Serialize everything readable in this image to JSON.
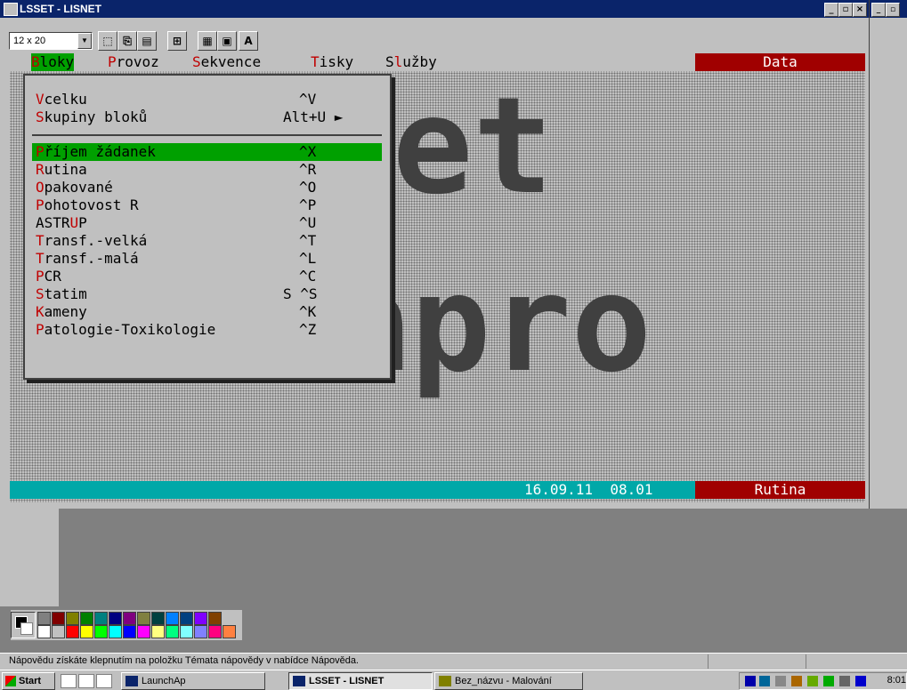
{
  "window": {
    "title": "LSSET - LISNET",
    "minimize": "_",
    "maximize": "▫",
    "close": "×"
  },
  "toolbar": {
    "font_size": "12 x 20",
    "font_button": "A"
  },
  "menubar": {
    "items": [
      {
        "hot": "B",
        "rest": "loky"
      },
      {
        "hot": "P",
        "rest": "rovoz"
      },
      {
        "hot": "S",
        "rest": "ekvence"
      },
      {
        "hot": "T",
        "rest": "isky"
      },
      {
        "pre": "S",
        "hot": "l",
        "rest": "užby"
      }
    ],
    "data_label": "Data"
  },
  "dropdown": {
    "top": [
      {
        "hot": "V",
        "rest": "celku",
        "shortcut": "^V"
      },
      {
        "hot": "S",
        "rest": "kupiny bloků",
        "shortcut": "Alt+U ►"
      }
    ],
    "items": [
      {
        "hot": "P",
        "rest": "říjem žádanek",
        "shortcut": "^X"
      },
      {
        "hot": "R",
        "rest": "utina",
        "shortcut": "^R"
      },
      {
        "hot": "O",
        "rest": "pakované",
        "shortcut": "^O"
      },
      {
        "hot": "P",
        "rest": "ohotovost R",
        "shortcut": "^P"
      },
      {
        "pre": "ASTR",
        "hot": "U",
        "rest": "P",
        "shortcut": "^U"
      },
      {
        "hot": "T",
        "rest": "ransf.-velká",
        "shortcut": "^T"
      },
      {
        "hot": "T",
        "rest": "ransf.-malá",
        "shortcut": "^L"
      },
      {
        "hot": "P",
        "rest": "CR",
        "shortcut": "^C"
      },
      {
        "hot": "S",
        "rest": "tatim",
        "shortcut": "S ^S"
      },
      {
        "hot": "K",
        "rest": "ameny",
        "shortcut": "^K"
      },
      {
        "hot": "P",
        "rest": "atologie-Toxikologie",
        "shortcut": "^Z"
      }
    ]
  },
  "logo": {
    "line1": "et",
    "line2": "apro"
  },
  "status": {
    "date": "16.09.11",
    "time": "08.01",
    "mode": "Rutina"
  },
  "paint": {
    "hint": "Nápovědu získáte klepnutím na položku Témata nápovědy v nabídce Nápověda.",
    "colors_top": [
      "#808080",
      "#800000",
      "#808000",
      "#008000",
      "#008080",
      "#000080",
      "#800080",
      "#808040",
      "#004040",
      "#0080ff",
      "#004080",
      "#8000ff",
      "#804000"
    ],
    "colors_bottom": [
      "#ffffff",
      "#c0c0c0",
      "#ff0000",
      "#ffff00",
      "#00ff00",
      "#00ffff",
      "#0000ff",
      "#ff00ff",
      "#ffff80",
      "#00ff80",
      "#80ffff",
      "#8080ff",
      "#ff0080",
      "#ff8040"
    ]
  },
  "taskbar": {
    "start": "Start",
    "tasks": [
      {
        "label": "LaunchAp"
      },
      {
        "label": "LSSET - LISNET"
      },
      {
        "label": "Bez_názvu - Malování"
      }
    ],
    "clock": "8:01"
  }
}
